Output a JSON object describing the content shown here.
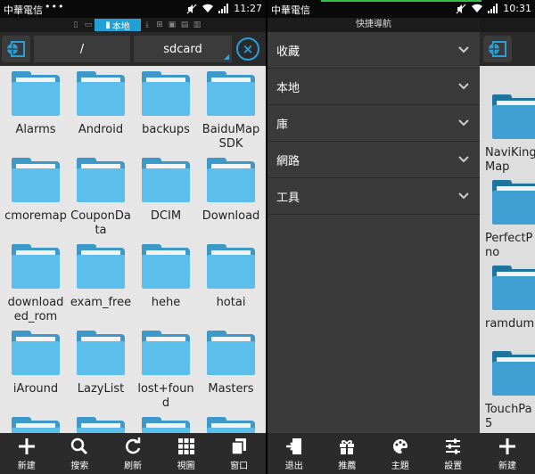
{
  "left_screen": {
    "status": {
      "carrier": "中華電信",
      "dots": "•••",
      "time": "11:27"
    },
    "location_tabs": {
      "active_label": "本地"
    },
    "path": {
      "root": "/",
      "current": "sdcard"
    },
    "files": [
      {
        "name": "Alarms"
      },
      {
        "name": "Android"
      },
      {
        "name": "backups"
      },
      {
        "name": "BaiduMap SDK"
      },
      {
        "name": "cmoremap"
      },
      {
        "name": "CouponData"
      },
      {
        "name": "DCIM"
      },
      {
        "name": "Download"
      },
      {
        "name": "downloaded_rom"
      },
      {
        "name": "exam_free"
      },
      {
        "name": "hehe"
      },
      {
        "name": "hotai"
      },
      {
        "name": "iAround"
      },
      {
        "name": "LazyList"
      },
      {
        "name": "lost+found"
      },
      {
        "name": "Masters"
      }
    ],
    "toolbar": [
      {
        "label": "新建",
        "icon": "plus-icon"
      },
      {
        "label": "搜索",
        "icon": "search-icon"
      },
      {
        "label": "刷新",
        "icon": "refresh-icon"
      },
      {
        "label": "視圖",
        "icon": "grid-view-icon"
      },
      {
        "label": "窗口",
        "icon": "windows-icon"
      }
    ]
  },
  "right_screen": {
    "status": {
      "carrier": "中華電信",
      "time": "10:31"
    },
    "drawer": {
      "title": "快捷導航",
      "items": [
        {
          "label": "收藏"
        },
        {
          "label": "本地"
        },
        {
          "label": "庫"
        },
        {
          "label": "網路"
        },
        {
          "label": "工具"
        }
      ],
      "toolbar": [
        {
          "label": "退出",
          "icon": "exit-icon"
        },
        {
          "label": "推薦",
          "icon": "gift-icon"
        },
        {
          "label": "主題",
          "icon": "palette-icon"
        },
        {
          "label": "設置",
          "icon": "settings-sliders-icon"
        }
      ]
    },
    "background_files": [
      {
        "name": "NaviKing\nMap"
      },
      {
        "name": "PerfectP\nno"
      },
      {
        "name": "ramdum"
      },
      {
        "name": "TouchPa\n5"
      }
    ],
    "background_toolbar": {
      "label": "新建"
    }
  },
  "colors": {
    "accent": "#1fa1d6",
    "folder_front": "#5cbfeb",
    "folder_back": "#3c99c9",
    "toolbar_bg": "#2b2b2b",
    "drawer_bg": "#3a3a3a",
    "top_progress_line": "#2fbf4a"
  }
}
